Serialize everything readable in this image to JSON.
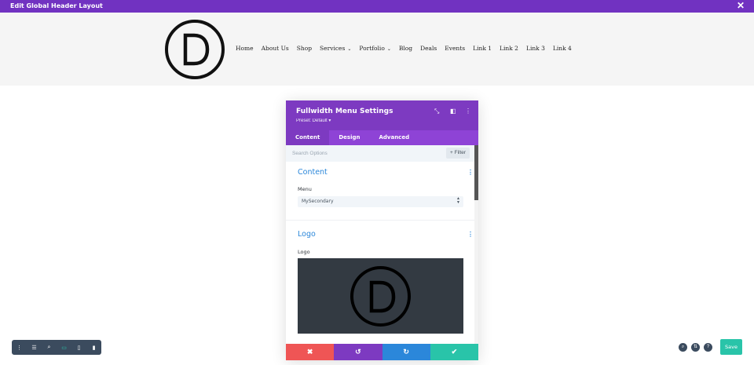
{
  "topbar": {
    "title": "Edit Global Header Layout",
    "close_icon": "✕"
  },
  "header": {
    "nav": [
      {
        "label": "Home",
        "dropdown": false
      },
      {
        "label": "About Us",
        "dropdown": false
      },
      {
        "label": "Shop",
        "dropdown": false
      },
      {
        "label": "Services",
        "dropdown": true
      },
      {
        "label": "Portfolio",
        "dropdown": true
      },
      {
        "label": "Blog",
        "dropdown": false
      },
      {
        "label": "Deals",
        "dropdown": false
      },
      {
        "label": "Events",
        "dropdown": false
      },
      {
        "label": "Link 1",
        "dropdown": false
      },
      {
        "label": "Link 2",
        "dropdown": false
      },
      {
        "label": "Link 3",
        "dropdown": false
      },
      {
        "label": "Link 4",
        "dropdown": false
      }
    ],
    "caret": "⌄"
  },
  "modal": {
    "title": "Fullwidth Menu Settings",
    "preset": "Preset: Default ▾",
    "tabs": [
      "Content",
      "Design",
      "Advanced"
    ],
    "search_placeholder": "Search Options",
    "filter_label": "+ Filter",
    "sections": {
      "content": {
        "title": "Content",
        "menu_label": "Menu",
        "menu_value": "MySecondary"
      },
      "logo": {
        "title": "Logo",
        "logo_label": "Logo"
      }
    },
    "footer": {
      "discard": "✖",
      "undo": "↺",
      "redo": "↻",
      "save": "✔"
    }
  },
  "bottom_right": {
    "save_label": "Save"
  },
  "colors": {
    "purple": "#7d3ac1",
    "topbar": "#7132c1",
    "teal": "#29c4a9",
    "blue": "#2b87da",
    "red": "#ef5555"
  }
}
